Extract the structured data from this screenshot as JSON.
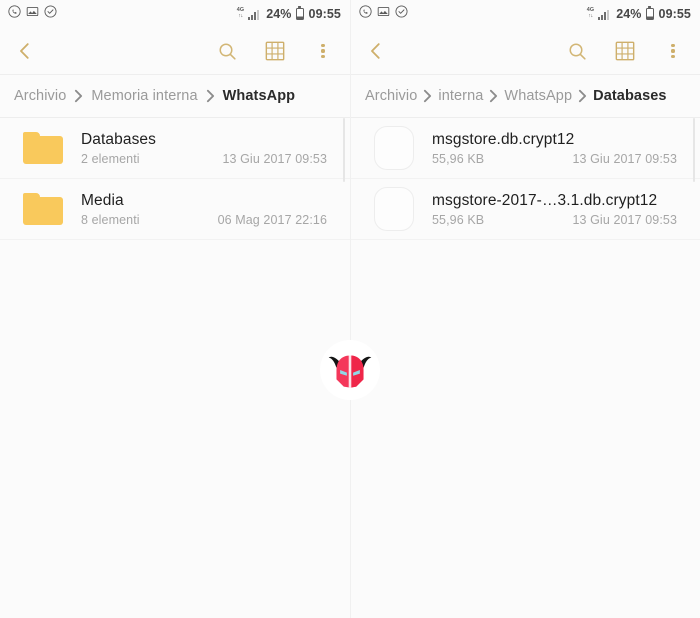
{
  "meta": {
    "app": "Samsung My Files (Archivio)",
    "language": "it"
  },
  "colors": {
    "accent_gold": "#ceaf6b",
    "folder_yellow": "#f9c95c",
    "background": "#fbfbfb",
    "title_text": "#1f1f1f",
    "muted_text": "#a6a6a6",
    "logo_red": "#f4375a",
    "logo_eye": "#8fd8e6"
  },
  "status_bar": {
    "left_icons": [
      {
        "name": "whatsapp-icon",
        "label": "WhatsApp"
      },
      {
        "name": "image-icon",
        "label": "Screenshot"
      },
      {
        "name": "shield-check-icon",
        "label": "Secure"
      }
    ],
    "network_type": "4G",
    "network_top": "4G",
    "network_bottom": "↑↓",
    "battery_percent": "24%",
    "time": "09:55"
  },
  "toolbar": {
    "back_label": "Indietro",
    "search_label": "Cerca",
    "grid_label": "Vista griglia",
    "more_label": "Altro"
  },
  "panels": [
    {
      "id": "left",
      "breadcrumb": [
        {
          "label": "Archivio",
          "current": false
        },
        {
          "label": "Memoria interna",
          "current": false
        },
        {
          "label": "WhatsApp",
          "current": true
        }
      ],
      "items": [
        {
          "icon": "folder-icon",
          "type": "folder",
          "name": "Databases",
          "meta": "2 elementi",
          "date": "13 Giu 2017 09:53"
        },
        {
          "icon": "folder-icon",
          "type": "folder",
          "name": "Media",
          "meta": "8 elementi",
          "date": "06 Mag 2017 22:16"
        }
      ]
    },
    {
      "id": "right",
      "breadcrumb": [
        {
          "label": "Archivio",
          "current": false
        },
        {
          "label": "interna",
          "current": false
        },
        {
          "label": "WhatsApp",
          "current": false
        },
        {
          "label": "Databases",
          "current": true
        }
      ],
      "items": [
        {
          "icon": "file-icon",
          "type": "file",
          "name": "msgstore.db.crypt12",
          "meta": "55,96 KB",
          "date": "13 Giu 2017 09:53"
        },
        {
          "icon": "file-icon",
          "type": "file",
          "name": "msgstore-2017-…3.1.db.crypt12",
          "meta": "55,96 KB",
          "date": "13 Giu 2017 09:53"
        }
      ]
    }
  ],
  "watermark": {
    "name": "devil-helmet-logo",
    "alt": "Red horned helmet logo"
  }
}
